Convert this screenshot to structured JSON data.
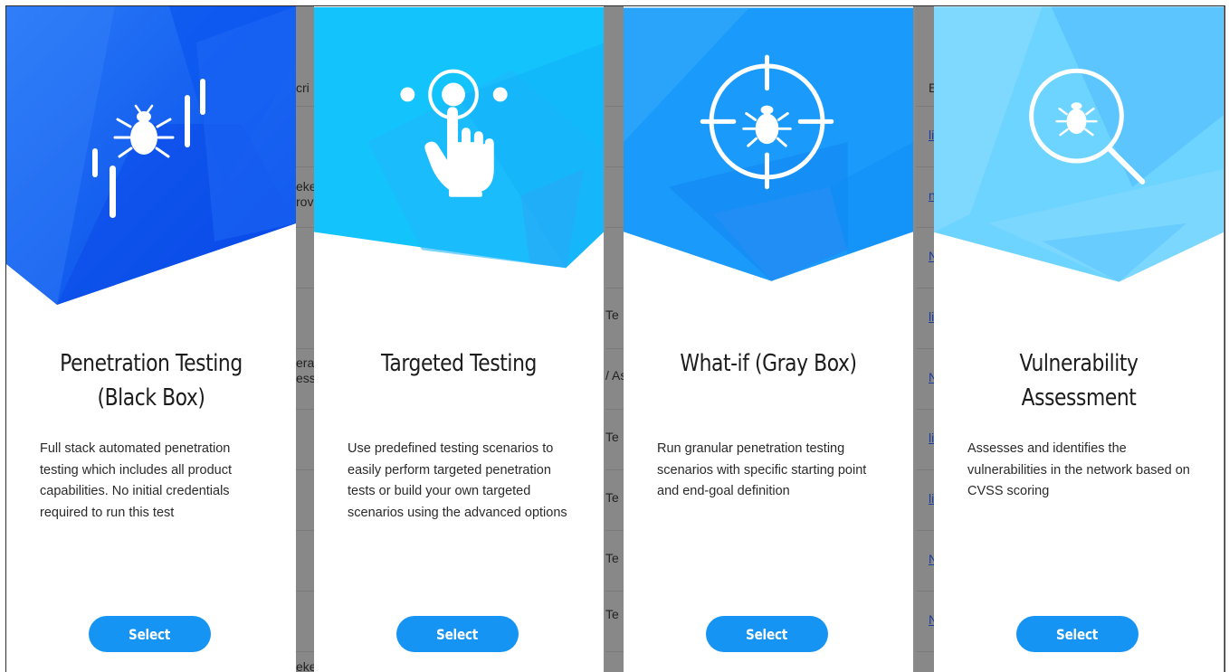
{
  "cards": [
    {
      "title_line1": "Penetration Testing",
      "title_line2": "(Black Box)",
      "description": "Full stack automated penetration testing which includes all product capabilities. No initial credentials required to run this test",
      "button": "Select",
      "icon": "bug-signal-bars-icon"
    },
    {
      "title_line1": "Targeted Testing",
      "title_line2": "",
      "description": "Use predefined testing scenarios to easily perform targeted penetration tests or build your own targeted scenarios using the advanced options",
      "button": "Select",
      "icon": "pointing-hand-target-icon"
    },
    {
      "title_line1": "What-if (Gray Box)",
      "title_line2": "",
      "description": "Run granular penetration testing scenarios with specific starting point and end-goal definition",
      "button": "Select",
      "icon": "bug-crosshair-icon"
    },
    {
      "title_line1": "Vulnerability",
      "title_line2": "Assessment",
      "description": "Assesses and identifies the vulnerabilities in the network based on CVSS scoring",
      "button": "Select",
      "icon": "bug-magnifier-icon"
    }
  ],
  "background_table": {
    "col1": [
      "cri",
      "eke",
      "rov",
      "era",
      "ess",
      "eke"
    ],
    "col2": [
      "Te",
      "/ As",
      "Te",
      "Te",
      "Te",
      "Te"
    ],
    "col3": [
      "E",
      "li",
      "n",
      "N",
      "li",
      "N",
      "li",
      "li",
      "N",
      "N"
    ]
  },
  "colors": {
    "accent": "#1594f3",
    "hero1": "#0a5cf5",
    "hero2": "#12c1fb",
    "hero3": "#1a9bfb",
    "hero4": "#6cd2ff"
  }
}
